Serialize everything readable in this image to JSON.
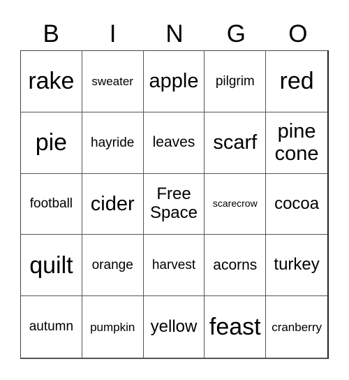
{
  "card": {
    "header_letters": [
      "B",
      "I",
      "N",
      "G",
      "O"
    ],
    "cells": [
      {
        "text": "rake",
        "size": "xl"
      },
      {
        "text": "sweater",
        "size": "xs"
      },
      {
        "text": "apple",
        "size": "l"
      },
      {
        "text": "pilgrim",
        "size": "s"
      },
      {
        "text": "red",
        "size": "xl"
      },
      {
        "text": "pie",
        "size": "xl"
      },
      {
        "text": "hayride",
        "size": "s"
      },
      {
        "text": "leaves",
        "size": "ms"
      },
      {
        "text": "scarf",
        "size": "l"
      },
      {
        "text": "pine cone",
        "size": "l"
      },
      {
        "text": "football",
        "size": "s"
      },
      {
        "text": "cider",
        "size": "l"
      },
      {
        "text": "Free Space",
        "size": "m"
      },
      {
        "text": "scarecrow",
        "size": "xxs"
      },
      {
        "text": "cocoa",
        "size": "m"
      },
      {
        "text": "quilt",
        "size": "xl"
      },
      {
        "text": "orange",
        "size": "s"
      },
      {
        "text": "harvest",
        "size": "s"
      },
      {
        "text": "acorns",
        "size": "ms"
      },
      {
        "text": "turkey",
        "size": "m"
      },
      {
        "text": "autumn",
        "size": "s"
      },
      {
        "text": "pumpkin",
        "size": "xs"
      },
      {
        "text": "yellow",
        "size": "m"
      },
      {
        "text": "feast",
        "size": "xl"
      },
      {
        "text": "cranberry",
        "size": "xs"
      }
    ]
  }
}
